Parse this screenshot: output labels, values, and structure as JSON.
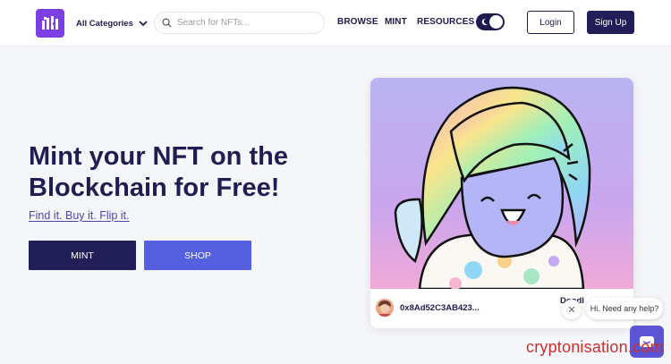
{
  "header": {
    "categories_label": "All Categories",
    "search_placeholder": "Search for NFTs...",
    "nav": [
      "BROWSE",
      "MINT",
      "RESOURCES"
    ],
    "login_label": "Login",
    "signup_label": "Sign Up"
  },
  "hero": {
    "title_line1": "Mint your NFT on the",
    "title_line2": "Blockchain for Free!",
    "subtitle": "Find it. Buy it. Flip it.",
    "mint_label": "MINT",
    "shop_label": "SHOP"
  },
  "nft": {
    "owner_address": "0x8Ad52C3AB423...",
    "name_partial": "Doodl"
  },
  "help": {
    "message": "Hi. Need any help?"
  },
  "watermark": "cryptonisation.com",
  "colors": {
    "brand_purple": "#7b3fe4",
    "navy": "#221e57",
    "shop_blue": "#5460df",
    "link_purple": "#4d46a8"
  },
  "icons": {
    "search": "search-icon",
    "chevron": "chevron-down-icon",
    "theme": "moon-icon",
    "close": "close-icon",
    "chat": "chat-icon"
  }
}
